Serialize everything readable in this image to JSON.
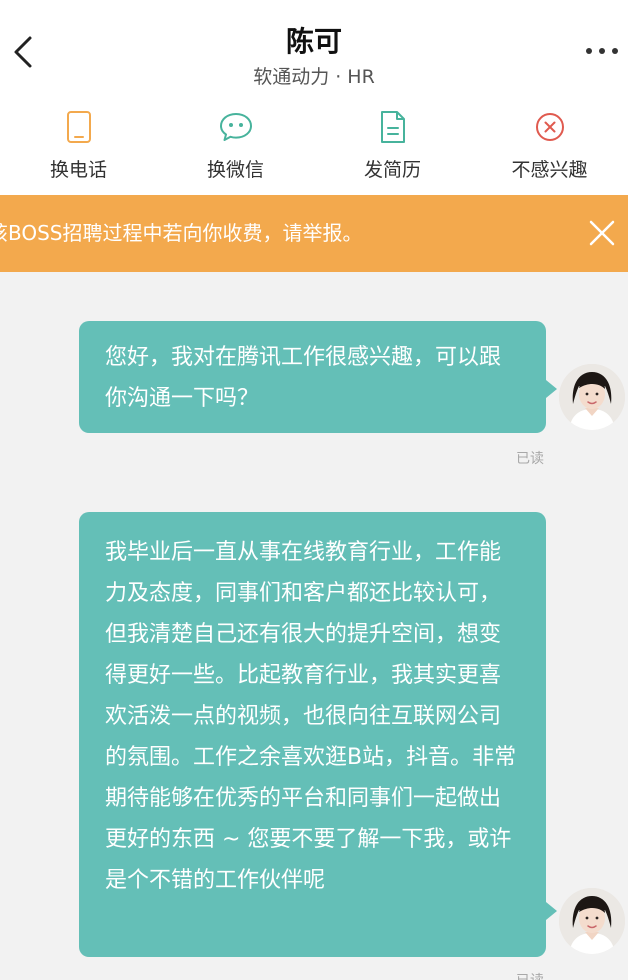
{
  "header": {
    "title": "陈可",
    "subtitle": "软通动力 · HR",
    "back_icon": "chevron-left-icon",
    "more_icon": "more-dots-icon"
  },
  "actions": [
    {
      "label": "换电话",
      "icon": "phone-icon",
      "color": "#f3a94d"
    },
    {
      "label": "换微信",
      "icon": "wechat-icon",
      "color": "#47b39c"
    },
    {
      "label": "发简历",
      "icon": "resume-icon",
      "color": "#47b39c"
    },
    {
      "label": "不感兴趣",
      "icon": "not-interested-icon",
      "color": "#e05a4f"
    }
  ],
  "notice": {
    "text": "该BOSS招聘过程中若向你收费，请举报。",
    "close_icon": "close-icon",
    "background": "#f3a94d"
  },
  "messages": [
    {
      "text": "您好，我对在腾讯工作很感兴趣，可以跟你沟通一下吗？",
      "status": "已读"
    },
    {
      "text": "我毕业后一直从事在线教育行业，工作能力及态度，同事们和客户都还比较认可，但我清楚自己还有很大的提升空间，想变得更好一些。比起教育行业，我其实更喜欢活泼一点的视频，也很向往互联网公司的氛围。工作之余喜欢逛B站，抖音。非常期待能够在优秀的平台和同事们一起做出更好的东西 ~ 您要不要了解一下我，或许是个不错的工作伙伴呢",
      "status": "已读"
    }
  ],
  "colors": {
    "bubble": "#64bfb7",
    "background": "#f2f2f2"
  }
}
